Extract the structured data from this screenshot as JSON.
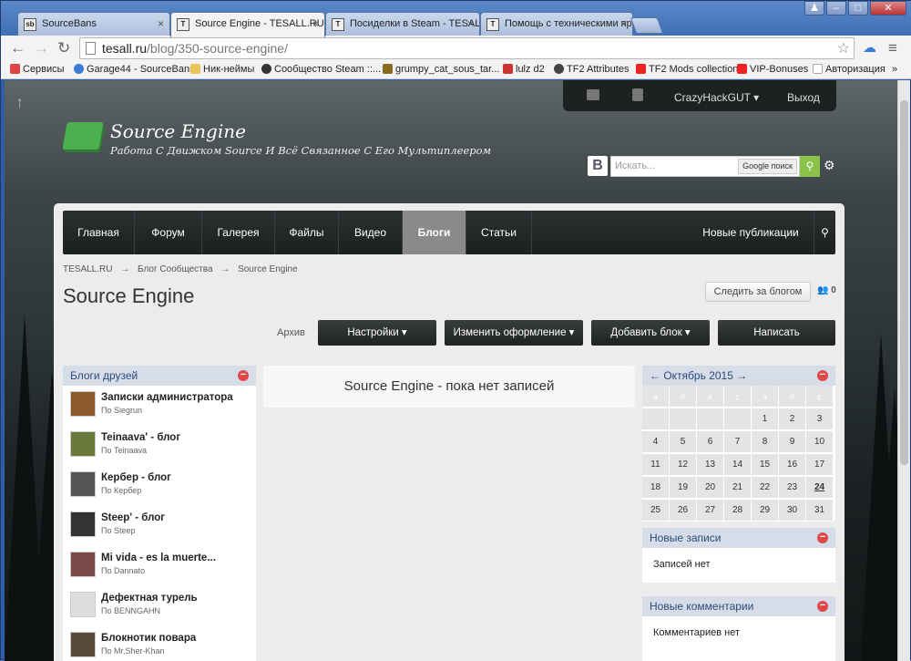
{
  "browser": {
    "tabs": [
      {
        "label": "SourceBans",
        "icon": "sb"
      },
      {
        "label": "Source Engine - TESALL.RU",
        "icon": "T"
      },
      {
        "label": "Посиделки в Steam - TESAL",
        "icon": "T"
      },
      {
        "label": "Помощь с техническими пр",
        "icon": "T"
      }
    ],
    "url_host": "tesall.ru",
    "url_path": "/blog/350-source-engine/",
    "bookmarks": [
      {
        "label": "Сервисы",
        "color": "#d44"
      },
      {
        "label": "Garage44 - SourceBans",
        "color": "#3a7bd5"
      },
      {
        "label": "Ник-неймы",
        "color": "#e8c45a"
      },
      {
        "label": "Сообщество Steam ::...",
        "color": "#333"
      },
      {
        "label": "grumpy_cat_sous_tar...",
        "color": "#8a6a20"
      },
      {
        "label": "lulz d2",
        "color": "#c33"
      },
      {
        "label": "TF2 Attributes",
        "color": "#444"
      },
      {
        "label": "TF2 Mods collection",
        "color": "#e22"
      },
      {
        "label": "VIP-Bonuses",
        "color": "#e22"
      },
      {
        "label": "Авторизация",
        "color": "#ccc"
      }
    ]
  },
  "site": {
    "title": "Source Engine",
    "subtitle": "Работа С Движком Source И Всё Связанное С Его Мультиплеером",
    "user": {
      "name": "CrazyHackGUT",
      "logout": "Выход"
    },
    "search": {
      "placeholder": "Искать...",
      "google_btn": "Google поиск",
      "vk": "В"
    },
    "nav": [
      "Главная",
      "Форум",
      "Галерея",
      "Файлы",
      "Видео",
      "Блоги",
      "Статьи"
    ],
    "nav_right": "Новые публикации",
    "breadcrumb": [
      "TESALL.RU",
      "Блог Сообщества",
      "Source Engine"
    ],
    "breadcrumb_sep": "→",
    "page_title": "Source Engine",
    "follow_button": "Следить за блогом",
    "follow_count": "0",
    "archive": "Архив",
    "actions": [
      "Настройки",
      "Изменить оформление",
      "Добавить блок",
      "Написать"
    ],
    "friends_panel": {
      "title": "Блоги друзей",
      "items": [
        {
          "name": "Записки администратора",
          "by": "По Siegrun"
        },
        {
          "name": "Teinaava' - блог",
          "by": "По Teinaava"
        },
        {
          "name": "Кербер - блог",
          "by": "По Кербер"
        },
        {
          "name": "Steep' - блог",
          "by": "По Steep"
        },
        {
          "name": "Mi vida - es la muerte...",
          "by": "По Dannato"
        },
        {
          "name": "Дефектная турель",
          "by": "По BENNGAHN"
        },
        {
          "name": "Блокнотик повара",
          "by": "По Mr.Sher-Khan"
        }
      ]
    },
    "empty_message": "Source Engine - пока нет записей",
    "calendar": {
      "title": "Октябрь 2015",
      "prev": "←",
      "next": "→",
      "weekdays": [
        "в",
        "п",
        "в",
        "с",
        "ч",
        "п",
        "с"
      ],
      "days": [
        "",
        "",
        "",
        "",
        "1",
        "2",
        "3",
        "4",
        "5",
        "6",
        "7",
        "8",
        "9",
        "10",
        "11",
        "12",
        "13",
        "14",
        "15",
        "16",
        "17",
        "18",
        "19",
        "20",
        "21",
        "22",
        "23",
        "24",
        "25",
        "26",
        "27",
        "28",
        "29",
        "30",
        "31"
      ],
      "today": "24"
    },
    "new_posts": {
      "title": "Новые записи",
      "text": "Записей нет"
    },
    "new_comments": {
      "title": "Новые комментарии",
      "text": "Комментариев нет"
    }
  }
}
